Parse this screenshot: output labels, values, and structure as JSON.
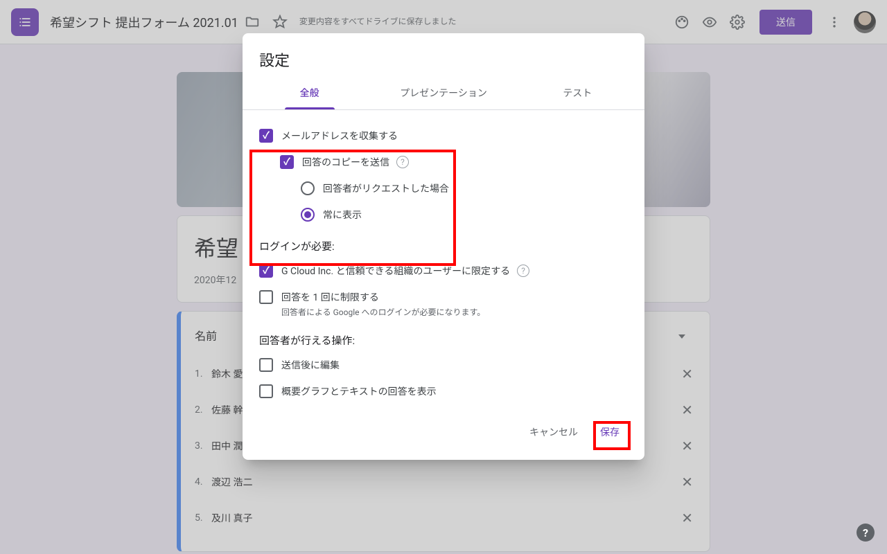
{
  "header": {
    "title": "希望シフト 提出フォーム 2021.01",
    "save_status": "変更内容をすべてドライブに保存しました",
    "send_label": "送信"
  },
  "form": {
    "hero_alt": "header-image",
    "title_snippet": "希望",
    "subtitle_snippet": "2020年12",
    "question_label": "名前",
    "options": [
      {
        "num": "1.",
        "label": "鈴木 愛"
      },
      {
        "num": "2.",
        "label": "佐藤 幹"
      },
      {
        "num": "3.",
        "label": "田中 潤"
      },
      {
        "num": "4.",
        "label": "渡辺 浩二"
      },
      {
        "num": "5.",
        "label": "及川 真子"
      }
    ]
  },
  "modal": {
    "title": "設定",
    "tabs": {
      "general": "全般",
      "presentation": "プレゼンテーション",
      "test": "テスト"
    },
    "collect_email": "メールアドレスを収集する",
    "send_copy": "回答のコピーを送信",
    "on_request": "回答者がリクエストした場合",
    "always": "常に表示",
    "login_heading": "ログインが必要:",
    "restrict_org": "G Cloud Inc. と信頼できる組織のユーザーに限定する",
    "limit_one": "回答を 1 回に制限する",
    "limit_one_sub": "回答者による Google へのログインが必要になります。",
    "resp_heading": "回答者が行える操作:",
    "edit_after": "送信後に編集",
    "show_summary": "概要グラフとテキストの回答を表示",
    "cancel": "キャンセル",
    "save": "保存"
  }
}
